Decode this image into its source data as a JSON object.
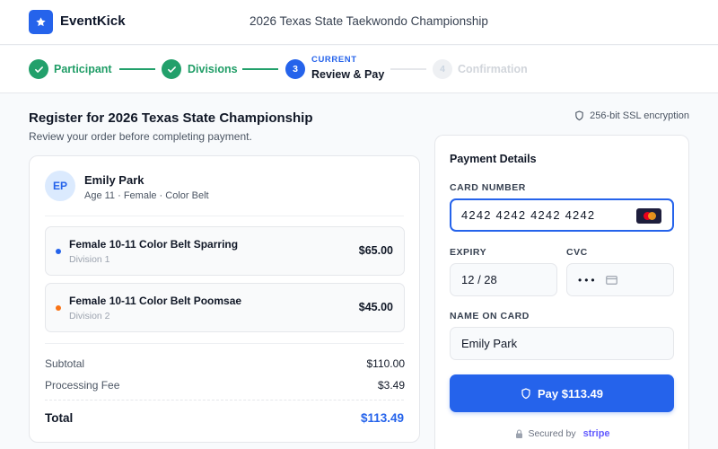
{
  "header": {
    "brand": "EventKick",
    "event_title": "2026 Texas State Taekwondo Championship",
    "brand_color": "#2563eb"
  },
  "stepper": {
    "steps": [
      {
        "number": "1",
        "label": "Participant",
        "status": "complete"
      },
      {
        "number": "2",
        "label": "Divisions",
        "status": "complete"
      },
      {
        "number": "3",
        "label": "Review & Pay",
        "status": "current",
        "tag": "CURRENT"
      },
      {
        "number": "4",
        "label": "Confirmation",
        "status": "upcoming"
      }
    ],
    "complete_color": "#22a06b"
  },
  "page": {
    "title": "Register for 2026 Texas State Championship",
    "subtitle": "Review your order before completing payment.",
    "ssl_note": "256-bit SSL encryption"
  },
  "order": {
    "participant": {
      "initials": "EP",
      "name": "Emily Park",
      "meta": "Age 11 · Female · Color Belt"
    },
    "divisions": [
      {
        "name": "Female 10-11 Color Belt Sparring",
        "sub": "Division 1",
        "price": "$65.00",
        "dot_color": "#2563eb"
      },
      {
        "name": "Female 10-11 Color Belt Poomsae",
        "sub": "Division 2",
        "price": "$45.00",
        "dot_color": "#f97316"
      }
    ],
    "subtotal_label": "Subtotal",
    "subtotal": "$110.00",
    "fee_label": "Processing Fee",
    "fee": "$3.49",
    "total_label": "Total",
    "total": "$113.49"
  },
  "payment": {
    "title": "Payment Details",
    "card_number_label": "CARD NUMBER",
    "card_number": "4242 4242 4242 4242",
    "card_brand_icon": "mastercard-icon",
    "expiry_label": "EXPIRY",
    "expiry": "12 / 28",
    "cvc_label": "CVC",
    "cvc": "•••",
    "name_label": "NAME ON CARD",
    "name": "Emily Park",
    "pay_button": "Pay $113.49",
    "secured_by": "Secured by",
    "processor": "stripe"
  }
}
